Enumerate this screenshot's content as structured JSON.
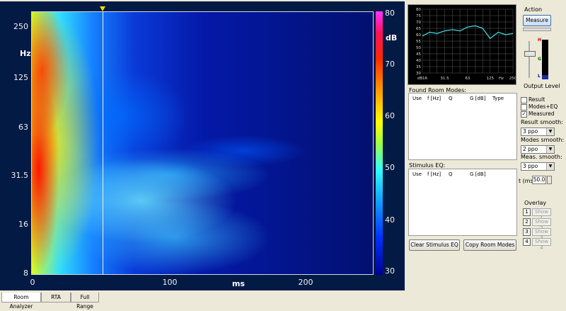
{
  "plot": {
    "y_unit": "Hz",
    "y_ticks": [
      "250",
      "125",
      "63",
      "31.5",
      "16",
      "8"
    ],
    "x_unit": "ms",
    "x_ticks": [
      "0",
      "100",
      "200"
    ],
    "colorbar_unit": "dB",
    "colorbar_ticks": [
      "80",
      "70",
      "60",
      "50",
      "40",
      "30"
    ]
  },
  "mini_chart": {
    "y_ticks": [
      "80",
      "75",
      "70",
      "65",
      "60",
      "55",
      "50",
      "45",
      "40",
      "35",
      "30"
    ],
    "x_ticks": [
      "dB16",
      "31.5",
      "63",
      "125",
      "Hz",
      "250"
    ]
  },
  "chart_data": {
    "type": "line",
    "x": [
      16,
      20,
      25,
      31.5,
      40,
      50,
      63,
      80,
      100,
      125,
      160,
      200,
      250
    ],
    "series": [
      {
        "values": [
          59,
          62,
          61,
          63,
          64,
          63,
          66,
          67,
          65,
          57,
          62,
          60,
          61
        ]
      }
    ],
    "ylim": [
      30,
      80
    ],
    "grid": true,
    "xscale": "log"
  },
  "action": {
    "title": "Action",
    "measure_label": "Measure",
    "output_level_label": "Output Level",
    "meter_h": "H",
    "meter_g": "G",
    "meter_l": "L"
  },
  "found_room_modes": {
    "label": "Found Room Modes:",
    "headers": [
      "Use",
      "f [Hz]",
      "Q",
      "G [dB]",
      "Type"
    ]
  },
  "stimulus_eq": {
    "label": "Stimulus EQ:",
    "headers": [
      "Use",
      "f [Hz]",
      "Q",
      "G [dB]"
    ]
  },
  "checks": [
    {
      "label": "Result",
      "checked": false
    },
    {
      "label": "Modes+EQ",
      "checked": false
    },
    {
      "label": "Measured",
      "checked": true
    }
  ],
  "result_smooth": {
    "label": "Result smooth:",
    "value": "3 ppo"
  },
  "modes_smooth": {
    "label": "Modes smooth:",
    "value": "2 ppo"
  },
  "meas_smooth": {
    "label": "Meas. smooth:",
    "value": "3 ppo"
  },
  "time": {
    "label": "t (ms)",
    "value": "50.0"
  },
  "overlay": {
    "title": "Overlay",
    "buttons": [
      "1",
      "2",
      "3",
      "4"
    ],
    "shows": [
      "Show 1",
      "Show 2",
      "Show 3",
      "Show 4"
    ]
  },
  "buttons": {
    "clear_eq": "Clear Stimulus EQ",
    "copy_modes": "Copy Room Modes"
  },
  "tabs": [
    "Room Analyzer",
    "RTA",
    "Full Range"
  ]
}
